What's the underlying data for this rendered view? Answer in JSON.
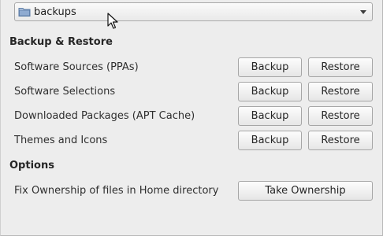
{
  "folder_chooser": {
    "value": "backups",
    "icon": "folder-icon"
  },
  "backup_restore": {
    "title": "Backup & Restore",
    "backup_label": "Backup",
    "restore_label": "Restore",
    "rows": [
      {
        "label": "Software Sources (PPAs)"
      },
      {
        "label": "Software Selections"
      },
      {
        "label": "Downloaded Packages (APT Cache)"
      },
      {
        "label": "Themes and Icons"
      }
    ]
  },
  "options": {
    "title": "Options",
    "ownership_label": "Fix Ownership of files in Home directory",
    "ownership_button": "Take Ownership"
  },
  "colors": {
    "background": "#ededed",
    "button_border": "#a6a6a6",
    "folder_icon": "#6a8fbf"
  }
}
